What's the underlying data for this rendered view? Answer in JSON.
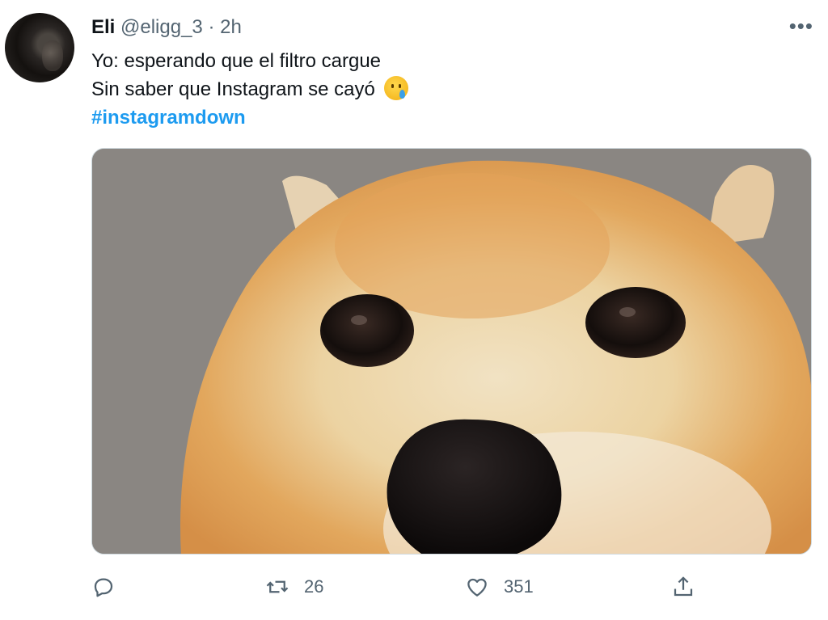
{
  "tweet": {
    "author_name": "Eli",
    "author_handle": "@eligg_3",
    "separator": "·",
    "time": "2h",
    "more_label": "•••",
    "lines": [
      "Yo: esperando que el filtro cargue",
      "Sin saber que Instagram se cayó"
    ],
    "hashtag": "#instagramdown",
    "emoji_icon": "smiling-face-with-tear-icon",
    "media": {
      "content": "close-up photo of a shiba inu dog face",
      "colors": {
        "background": "#8b8783",
        "fur": "#e2a860",
        "cream": "#efe0bf",
        "nose": "#1a1616"
      }
    },
    "actions": {
      "reply_icon": "reply-icon",
      "retweet_icon": "retweet-icon",
      "retweet_count": "26",
      "like_icon": "heart-icon",
      "like_count": "351",
      "share_icon": "share-icon"
    }
  },
  "colors": {
    "accent": "#1d9bf0",
    "text": "#0f1419",
    "muted": "#536471"
  }
}
